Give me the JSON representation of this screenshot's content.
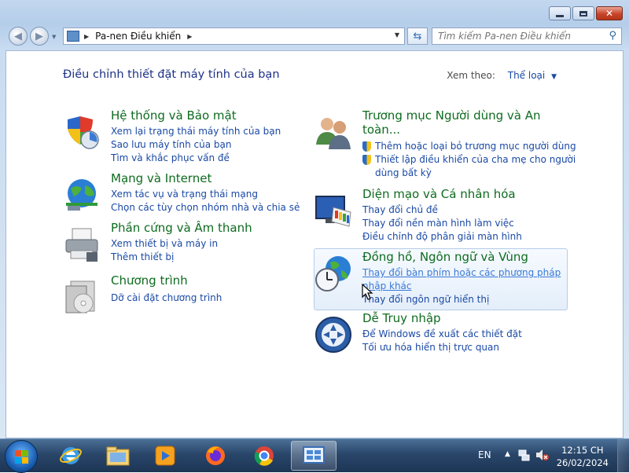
{
  "window": {
    "breadcrumb": "Pa-nen Điều khiển",
    "search_placeholder": "Tìm kiếm Pa-nen Điều khiển"
  },
  "main": {
    "heading": "Điều chỉnh thiết đặt máy tính của bạn",
    "view_by_label": "Xem theo:",
    "view_by_value": "Thể loại"
  },
  "categories": [
    {
      "title": "Hệ thống và Bảo mật",
      "icon": "shield-icon",
      "links": [
        "Xem lại trạng thái máy tính của bạn",
        "Sao lưu máy tính của bạn",
        "Tìm và khắc phục vấn đề"
      ]
    },
    {
      "title": "Mạng và Internet",
      "icon": "network-globe-icon",
      "links": [
        "Xem tác vụ và trạng thái mạng",
        "Chọn các tùy chọn nhóm nhà và chia sẻ"
      ]
    },
    {
      "title": "Phần cứng và Âm thanh",
      "icon": "printer-icon",
      "links": [
        "Xem thiết bị và máy in",
        "Thêm thiết bị"
      ]
    },
    {
      "title": "Chương trình",
      "icon": "programs-icon",
      "links": [
        "Dỡ cài đặt chương trình"
      ]
    },
    {
      "title_line1": "Trương mục Người dùng và An",
      "title_line2": "toàn...",
      "icon": "users-icon",
      "links": [
        "Thêm hoặc loại bỏ trương mục người dùng",
        "Thiết lập điều khiển của cha mẹ cho người",
        "dùng bất kỳ"
      ]
    },
    {
      "title": "Diện mạo và Cá nhân hóa",
      "icon": "monitor-palette-icon",
      "links": [
        "Thay đổi chủ đề",
        "Thay đổi nền màn hình làm việc",
        "Điều chỉnh độ phân giải màn hình"
      ]
    },
    {
      "title": "Đồng hồ, Ngôn ngữ và Vùng",
      "icon": "clock-globe-icon",
      "links": [
        "Thay đổi bàn phím hoặc các phương pháp",
        "nhập khác",
        "Thay đổi ngôn ngữ hiển thị"
      ]
    },
    {
      "title": "Dễ Truy nhập",
      "icon": "ease-of-access-icon",
      "links": [
        "Để Windows đề xuất các thiết đặt",
        "Tối ưu hóa hiển thị trực quan"
      ]
    }
  ],
  "taskbar": {
    "lang": "EN",
    "time": "12:15 CH",
    "date": "26/02/2024",
    "apps": [
      "internet-explorer-icon",
      "file-explorer-icon",
      "media-player-icon",
      "firefox-icon",
      "chrome-icon",
      "control-panel-icon"
    ]
  },
  "colors": {
    "category_title": "#0e6b1f",
    "link": "#1a49a5",
    "heading": "#1e3287"
  }
}
